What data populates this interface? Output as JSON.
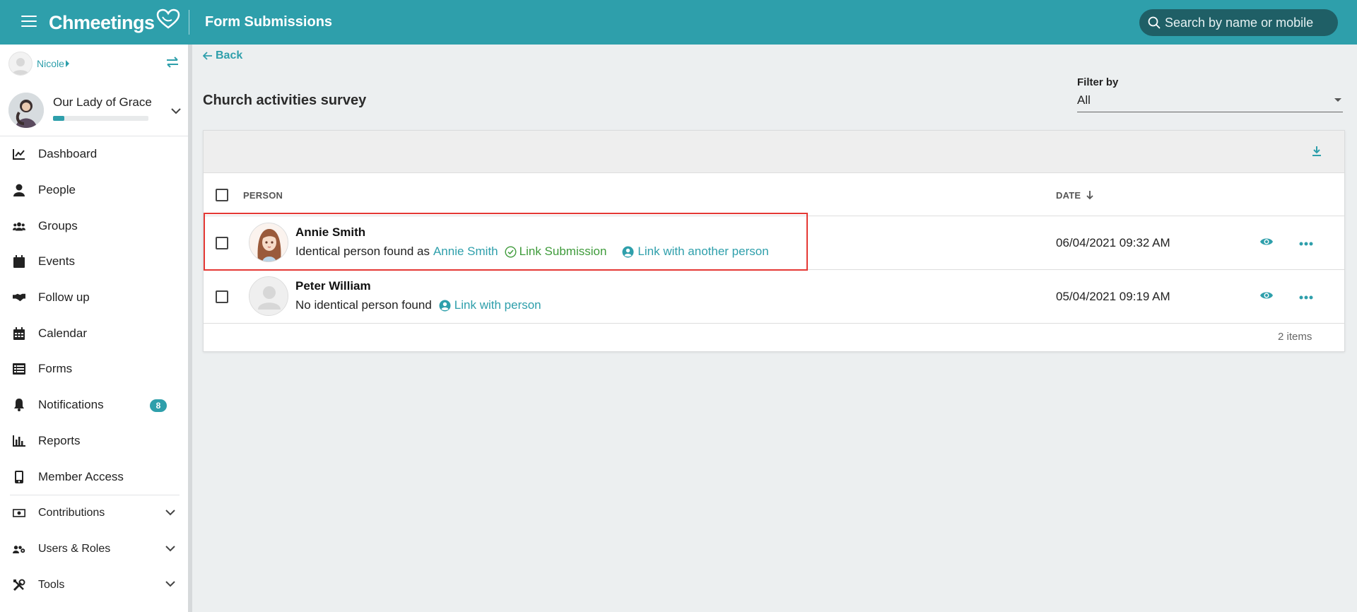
{
  "header": {
    "app_name": "Chmeetings",
    "page_title": "Form Submissions",
    "search_placeholder": "Search by name or mobile"
  },
  "sidebar": {
    "user_name": "Nicole",
    "church_name": "Our Lady of Grace",
    "church_progress": 0.12,
    "items": [
      {
        "label": "Dashboard",
        "icon": "chart-line-icon"
      },
      {
        "label": "People",
        "icon": "person-icon"
      },
      {
        "label": "Groups",
        "icon": "users-icon"
      },
      {
        "label": "Events",
        "icon": "calendar-event-icon"
      },
      {
        "label": "Follow up",
        "icon": "handshake-icon"
      },
      {
        "label": "Calendar",
        "icon": "calendar-icon"
      },
      {
        "label": "Forms",
        "icon": "list-icon"
      },
      {
        "label": "Notifications",
        "icon": "bell-icon",
        "badge": "8"
      },
      {
        "label": "Reports",
        "icon": "bar-chart-icon"
      },
      {
        "label": "Member Access",
        "icon": "mobile-icon"
      },
      {
        "label": "Contributions",
        "icon": "money-icon",
        "expandable": true
      },
      {
        "label": "Users & Roles",
        "icon": "users-cog-icon",
        "expandable": true
      },
      {
        "label": "Tools",
        "icon": "tools-icon",
        "expandable": true
      }
    ]
  },
  "main": {
    "back_label": "Back",
    "form_title": "Church activities survey",
    "filter_label": "Filter by",
    "filter_value": "All",
    "table": {
      "columns": {
        "person": "PERSON",
        "date": "DATE"
      },
      "rows": [
        {
          "name": "Annie Smith",
          "status_text": "Identical person found as",
          "match_name": "Annie Smith",
          "link_submission": "Link Submission",
          "link_other": "Link with another person",
          "date": "06/04/2021 09:32 AM"
        },
        {
          "name": "Peter William",
          "status_text": "No identical person found",
          "link_person": "Link with person",
          "date": "05/04/2021 09:19 AM"
        }
      ],
      "items_count": "2 items"
    }
  },
  "colors": {
    "accent": "#2e9fab",
    "success": "#3f9b3b",
    "highlight": "#e53935"
  }
}
